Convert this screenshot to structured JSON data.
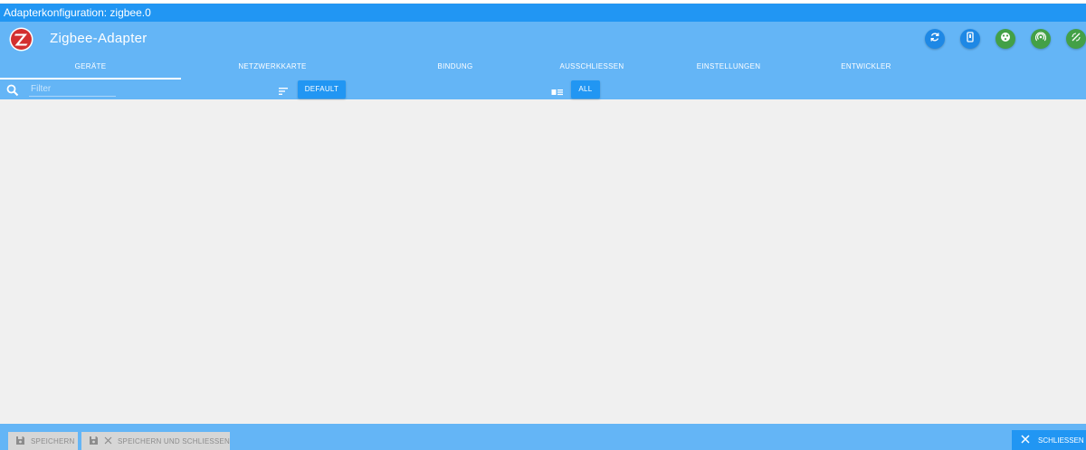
{
  "window": {
    "title": "Adapterkonfiguration: zigbee.0"
  },
  "header": {
    "app_name": "Zigbee-Adapter",
    "logo": "zigbee-logo",
    "actions": [
      {
        "icon": "refresh-icon",
        "color": "#1e88e5"
      },
      {
        "icon": "phone-device-icon",
        "color": "#1e88e5"
      },
      {
        "icon": "network-icon",
        "color": "#43a047"
      },
      {
        "icon": "signal-icon",
        "color": "#43a047"
      },
      {
        "icon": "antenna-icon",
        "color": "#43a047"
      }
    ]
  },
  "tabs": [
    {
      "label": "GERÄTE",
      "active": true
    },
    {
      "label": "NETZWERKKARTE",
      "active": false
    },
    {
      "label": "BINDUNG",
      "active": false
    },
    {
      "label": "AUSSCHLIESSEN",
      "active": false
    },
    {
      "label": "EINSTELLUNGEN",
      "active": false
    },
    {
      "label": "ENTWICKLER",
      "active": false
    }
  ],
  "toolbar": {
    "filter_placeholder": "Filter",
    "filter_value": "",
    "sort_label": "DEFAULT",
    "view_label": "ALL"
  },
  "footer": {
    "save_label": "SPEICHERN",
    "save_close_label": "SPEICHERN UND SCHLIESSEN",
    "close_label": "SCHLIESSEN"
  },
  "colors": {
    "primary": "#2196f3",
    "header": "#64b5f6",
    "background": "#f0f0f0",
    "accent_green": "#43a047",
    "logo_red": "#d32f2f"
  }
}
